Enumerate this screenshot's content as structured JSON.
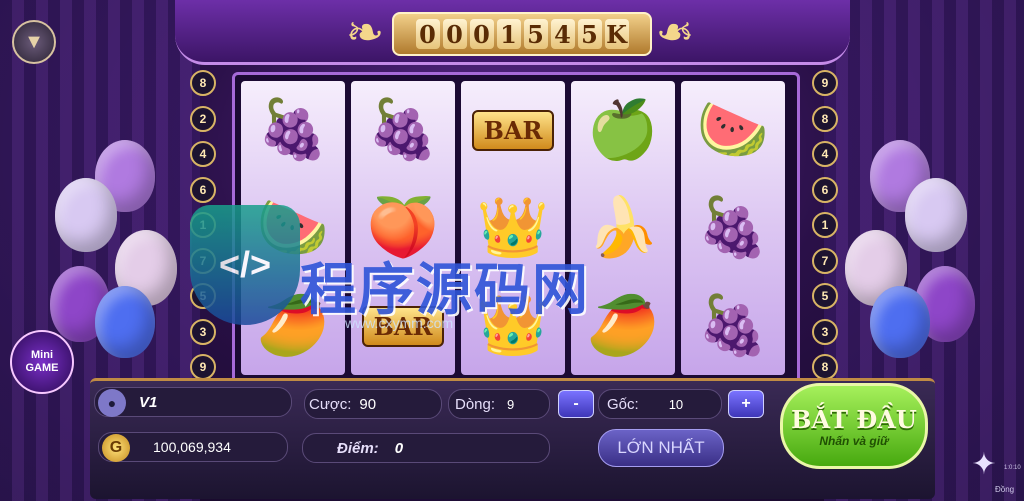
{
  "jackpot": {
    "digits": [
      "0",
      "0",
      "0",
      "1",
      "5",
      "4",
      "5",
      "K"
    ]
  },
  "lines_left": [
    "8",
    "2",
    "4",
    "6",
    "1",
    "7",
    "5",
    "3",
    "9"
  ],
  "lines_right": [
    "9",
    "8",
    "4",
    "6",
    "1",
    "7",
    "5",
    "3",
    "8"
  ],
  "reels": [
    [
      "grape-icon",
      "watermelon-icon",
      "mango-icon"
    ],
    [
      "grape-icon",
      "plum-icon",
      "BAR"
    ],
    [
      "BAR",
      "crown-icon",
      "crown-icon"
    ],
    [
      "apple-icon",
      "banana-icon",
      "mango-icon"
    ],
    [
      "watermelon-icon",
      "grape-icon",
      "grape-icon"
    ]
  ],
  "mini_game": {
    "line1": "Mini",
    "line2": "GAME"
  },
  "player": {
    "name": "V1",
    "balance": "100,069,934"
  },
  "bet": {
    "label": "Cược:",
    "value": "90"
  },
  "lines": {
    "label": "Dòng:",
    "value": "9"
  },
  "base": {
    "label": "Gốc:",
    "value": "10",
    "minus": "-",
    "plus": "+"
  },
  "points": {
    "label": "Điểm:",
    "value": "0"
  },
  "max_button": "LỚN NHẤT",
  "start_button": {
    "title": "BẮT ĐẦU",
    "subtitle": "Nhấn và giữ"
  },
  "watermark": {
    "text": "程序源码网",
    "code": "</>",
    "url": "www.cxymm.com"
  },
  "status": {
    "time": "1:0:10",
    "label": "Đồng"
  },
  "colors": {
    "accent": "#a66ad8",
    "gold": "#d8b465",
    "start_green": "#47a90f"
  }
}
